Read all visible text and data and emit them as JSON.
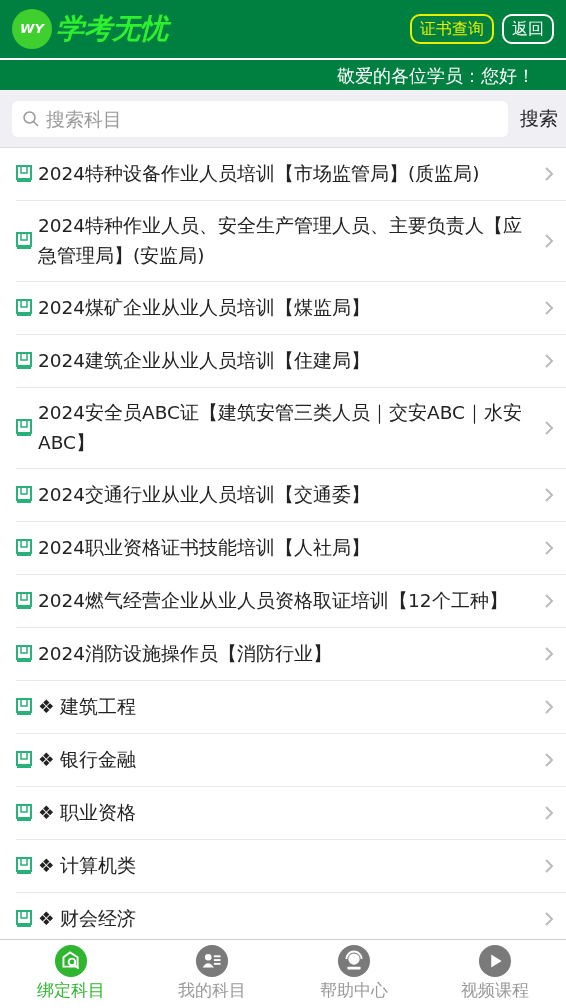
{
  "header": {
    "logo_mark": "WY",
    "app_name": "学考无忧",
    "buttons": [
      {
        "label": "证书查询",
        "kind": "highlight"
      },
      {
        "label": "返回",
        "kind": "plain"
      }
    ]
  },
  "notice": "敬爱的各位学员：您好！",
  "search": {
    "placeholder": "搜索科目",
    "button": "搜索"
  },
  "subjects": [
    {
      "label": "2024特种设备作业人员培训【市场监管局】(质监局)"
    },
    {
      "label": "2024特种作业人员、安全生产管理人员、主要负责人【应急管理局】(安监局)"
    },
    {
      "label": "2024煤矿企业从业人员培训【煤监局】"
    },
    {
      "label": "2024建筑企业从业人员培训【住建局】"
    },
    {
      "label": "2024安全员ABC证【建筑安管三类人员｜交安ABC｜水安ABC】"
    },
    {
      "label": "2024交通行业从业人员培训【交通委】"
    },
    {
      "label": "2024职业资格证书技能培训【人社局】"
    },
    {
      "label": "2024燃气经营企业从业人员资格取证培训【12个工种】"
    },
    {
      "label": "2024消防设施操作员【消防行业】"
    },
    {
      "label": "❖ 建筑工程"
    },
    {
      "label": "❖ 银行金融"
    },
    {
      "label": "❖ 职业资格"
    },
    {
      "label": "❖ 计算机类"
    },
    {
      "label": "❖ 财会经济"
    }
  ],
  "tabbar": [
    {
      "label": "绑定科目",
      "kind": "bind",
      "selected": true
    },
    {
      "label": "我的科目",
      "kind": "mine",
      "selected": false
    },
    {
      "label": "帮助中心",
      "kind": "help",
      "selected": false
    },
    {
      "label": "视频课程",
      "kind": "video",
      "selected": false
    }
  ]
}
